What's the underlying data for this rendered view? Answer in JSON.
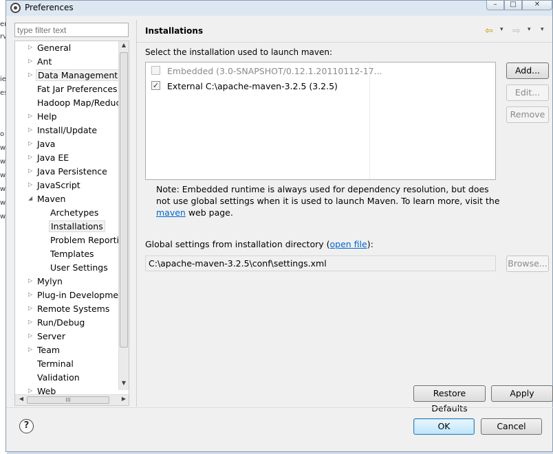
{
  "window": {
    "title": "Preferences",
    "controls": {
      "minimize": "–",
      "maximize": "□",
      "close": "✕"
    }
  },
  "behind_window_glyphs": [
    "er",
    "rv",
    "ie",
    "es",
    "o",
    "w",
    "w",
    "w",
    "w",
    "w",
    "w",
    "w"
  ],
  "sidebar": {
    "filter_placeholder": "type filter text",
    "items": [
      {
        "label": "General",
        "expander": "▷"
      },
      {
        "label": "Ant",
        "expander": "▷"
      },
      {
        "label": "Data Management",
        "expander": "▷"
      },
      {
        "label": "Fat Jar Preferences",
        "expander": ""
      },
      {
        "label": "Hadoop Map/Reduce",
        "expander": ""
      },
      {
        "label": "Help",
        "expander": "▷"
      },
      {
        "label": "Install/Update",
        "expander": "▷"
      },
      {
        "label": "Java",
        "expander": "▷"
      },
      {
        "label": "Java EE",
        "expander": "▷"
      },
      {
        "label": "Java Persistence",
        "expander": "▷"
      },
      {
        "label": "JavaScript",
        "expander": "▷"
      },
      {
        "label": "Maven",
        "expander": "◢"
      },
      {
        "label": "Archetypes",
        "expander": ""
      },
      {
        "label": "Installations",
        "expander": ""
      },
      {
        "label": "Problem Reporting",
        "expander": ""
      },
      {
        "label": "Templates",
        "expander": ""
      },
      {
        "label": "User Settings",
        "expander": ""
      },
      {
        "label": "Mylyn",
        "expander": "▷"
      },
      {
        "label": "Plug-in Development",
        "expander": "▷"
      },
      {
        "label": "Remote Systems",
        "expander": "▷"
      },
      {
        "label": "Run/Debug",
        "expander": "▷"
      },
      {
        "label": "Server",
        "expander": "▷"
      },
      {
        "label": "Team",
        "expander": "▷"
      },
      {
        "label": "Terminal",
        "expander": ""
      },
      {
        "label": "Validation",
        "expander": ""
      },
      {
        "label": "Web",
        "expander": "▷"
      }
    ],
    "scroll_up": "▲",
    "scroll_down": "▼",
    "scroll_left": "◀",
    "scroll_right": "▶",
    "grip": "III"
  },
  "header": {
    "title": "Installations",
    "back_icon": "⇦",
    "forward_icon": "⇨",
    "dropdown_icon": "▾"
  },
  "main": {
    "select_label": "Select the installation used to launch maven:",
    "installations": [
      {
        "label": "Embedded (3.0-SNAPSHOT/0.12.1.20110112-17...",
        "checked": false,
        "enabled": false
      },
      {
        "label": "External C:\\apache-maven-3.2.5 (3.2.5)",
        "checked": true,
        "enabled": true
      }
    ],
    "buttons": {
      "add": "Add...",
      "edit": "Edit...",
      "remove": "Remove",
      "browse": "Browse..."
    },
    "note_prefix": "Note: Embedded runtime is always used for dependency resolution, but does not use global settings when it is used to launch Maven. To learn more, visit the ",
    "note_link": "maven",
    "note_suffix": " web page.",
    "global_label_prefix": "Global settings from installation directory (",
    "global_label_link": "open file",
    "global_label_suffix": "):",
    "global_path": "C:\\apache-maven-3.2.5\\conf\\settings.xml"
  },
  "footer": {
    "restore_defaults": "Restore Defaults",
    "apply": "Apply",
    "ok": "OK",
    "cancel": "Cancel",
    "help_icon_glyph": "?"
  }
}
